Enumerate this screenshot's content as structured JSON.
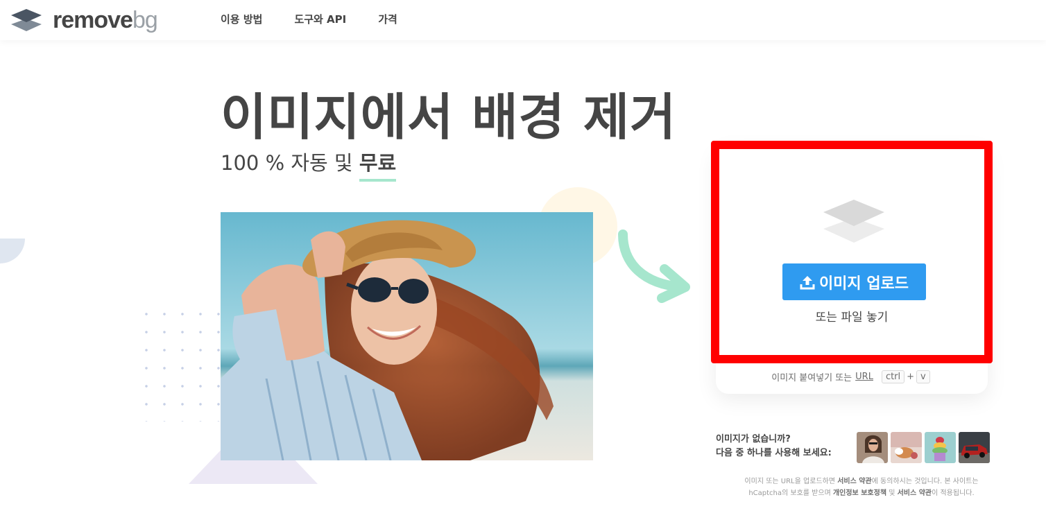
{
  "header": {
    "logo_remove": "remove",
    "logo_bg": "bg",
    "nav": [
      {
        "label": "이용 방법"
      },
      {
        "label": "도구와 API"
      },
      {
        "label": "가격"
      }
    ]
  },
  "hero": {
    "title": "이미지에서 배경 제거",
    "subtitle_prefix": "100 % 자동 및 ",
    "subtitle_emph": "무료"
  },
  "upload": {
    "button_label": "이미지 업로드",
    "drop_text": "또는 파일 놓기",
    "paste_text": "이미지 붙여넣기 또는",
    "paste_url": "URL",
    "kbd_ctrl": "ctrl",
    "kbd_plus": "+",
    "kbd_v": "v"
  },
  "samples": {
    "line1": "이미지가 없습니까?",
    "line2": "다음 중 하나를 사용해 보세요:",
    "items": [
      {
        "icon": "woman-sample-thumbnail"
      },
      {
        "icon": "puppy-sample-thumbnail"
      },
      {
        "icon": "cake-sample-thumbnail"
      },
      {
        "icon": "car-sample-thumbnail"
      }
    ]
  },
  "legal": {
    "l1_a": "이미지 또는 URL을 업로드하면 ",
    "l1_b": "서비스 약관",
    "l1_c": "에 동의하시는 것입니다. 본 사이트는",
    "l2_a": "hCaptcha의 보호를 받으며 ",
    "l2_b": "개인정보 보호정책",
    "l2_c": " 및 ",
    "l2_d": "서비스 약관",
    "l2_e": "이 적용됩니다."
  },
  "colors": {
    "accent": "#2f9bf0",
    "highlight": "#ff0000",
    "underline": "#a6e6cd",
    "arrow": "#a6e6cd"
  }
}
